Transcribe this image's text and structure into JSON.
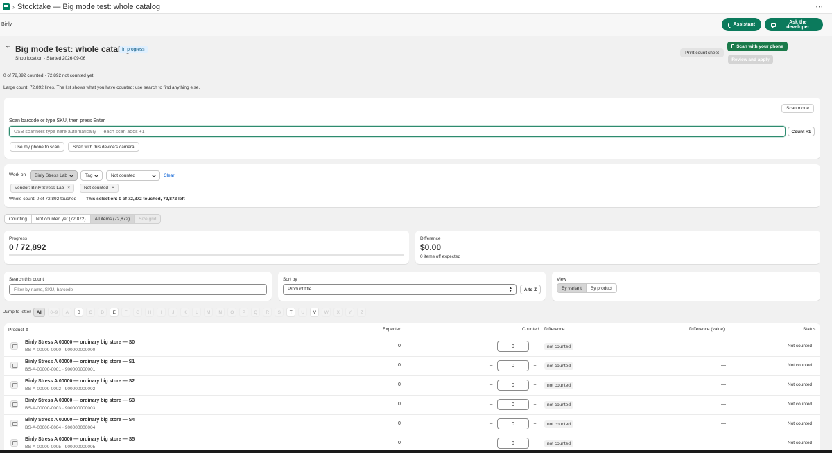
{
  "window": {
    "title": "Stocktake — Big mode test: whole catalog",
    "more": "⋯"
  },
  "appbar": {
    "brand": "Binly",
    "assistant": "Assistant",
    "ask_developer": "Ask the developer"
  },
  "header": {
    "title": "Big mode test: whole catalog",
    "status_badge": "In progress",
    "subtitle": "Shop location · Started 2026-09-06",
    "print_button": "Print count sheet",
    "scan_phone_button": "Scan with your phone",
    "review_button": "Review and apply",
    "counted_summary": "0 of 72,892 counted · 72,892 not counted yet",
    "large_note": "Large count: 72,892 lines. The list shows what you have counted; use search to find anything else."
  },
  "scan": {
    "mode_button": "Scan mode",
    "label": "Scan barcode or type SKU, then press Enter",
    "placeholder": "USB scanners type here automatically — each scan adds +1",
    "count_button": "Count +1",
    "phone_button": "Use my phone to scan",
    "camera_button": "Scan with this device's camera"
  },
  "filters": {
    "work_on_label": "Work on",
    "vendor_select": "Binly Stress Lab",
    "tag_select": "Tag",
    "status_select": "Not counted",
    "clear": "Clear",
    "chips": [
      "Vendor: Binly Stress Lab",
      "Not counted"
    ],
    "chip_remove": "×",
    "whole_count": "Whole count: 0 of 72,892 touched",
    "this_selection": "This selection: 0 of 72,872 touched, 72,872 left"
  },
  "tabs": [
    "Counting",
    "Not counted yet (72,872)",
    "All items (72,872)",
    "Size grid"
  ],
  "progress": {
    "label": "Progress",
    "value": "0 / 72,892",
    "fraction": 0.0
  },
  "difference": {
    "label": "Difference",
    "value": "$0.00",
    "sub": "0 items off expected"
  },
  "search": {
    "label": "Search this count",
    "placeholder": "Filter by name, SKU, barcode"
  },
  "sort": {
    "label": "Sort by",
    "value": "Product title",
    "order_button": "A to Z"
  },
  "view": {
    "label": "View",
    "by_variant": "By variant",
    "by_product": "By product"
  },
  "jump": {
    "label": "Jump to letter",
    "letters": [
      {
        "t": "All",
        "s": "active"
      },
      {
        "t": "0–9",
        "s": "disabled"
      },
      {
        "t": "A",
        "s": "disabled"
      },
      {
        "t": "B",
        "s": "enabled"
      },
      {
        "t": "C",
        "s": "disabled"
      },
      {
        "t": "D",
        "s": "disabled"
      },
      {
        "t": "E",
        "s": "enabled"
      },
      {
        "t": "F",
        "s": "disabled"
      },
      {
        "t": "G",
        "s": "disabled"
      },
      {
        "t": "H",
        "s": "disabled"
      },
      {
        "t": "I",
        "s": "disabled"
      },
      {
        "t": "J",
        "s": "disabled"
      },
      {
        "t": "K",
        "s": "disabled"
      },
      {
        "t": "L",
        "s": "disabled"
      },
      {
        "t": "M",
        "s": "disabled"
      },
      {
        "t": "N",
        "s": "disabled"
      },
      {
        "t": "O",
        "s": "disabled"
      },
      {
        "t": "P",
        "s": "disabled"
      },
      {
        "t": "Q",
        "s": "disabled"
      },
      {
        "t": "R",
        "s": "disabled"
      },
      {
        "t": "S",
        "s": "disabled"
      },
      {
        "t": "T",
        "s": "enabled"
      },
      {
        "t": "U",
        "s": "disabled"
      },
      {
        "t": "V",
        "s": "enabled"
      },
      {
        "t": "W",
        "s": "disabled"
      },
      {
        "t": "X",
        "s": "disabled"
      },
      {
        "t": "Y",
        "s": "disabled"
      },
      {
        "t": "Z",
        "s": "disabled"
      }
    ]
  },
  "table": {
    "headers": {
      "product": "Product",
      "expected": "Expected",
      "counted": "Counted",
      "difference": "Difference",
      "difference_value": "Difference (value)",
      "status": "Status"
    },
    "rows": [
      {
        "name": "Binly Stress A 00000 — ordinary big store — S0",
        "sku": "BS-A-00000-0000 · 900000000000",
        "expected": "0",
        "counted": "0",
        "diff": "not counted",
        "diff_value": "—",
        "status": "Not counted"
      },
      {
        "name": "Binly Stress A 00000 — ordinary big store — S1",
        "sku": "BS-A-00000-0001 · 900000000001",
        "expected": "0",
        "counted": "0",
        "diff": "not counted",
        "diff_value": "—",
        "status": "Not counted"
      },
      {
        "name": "Binly Stress A 00000 — ordinary big store — S2",
        "sku": "BS-A-00000-0002 · 900000000002",
        "expected": "0",
        "counted": "0",
        "diff": "not counted",
        "diff_value": "—",
        "status": "Not counted"
      },
      {
        "name": "Binly Stress A 00000 — ordinary big store — S3",
        "sku": "BS-A-00000-0003 · 900000000003",
        "expected": "0",
        "counted": "0",
        "diff": "not counted",
        "diff_value": "—",
        "status": "Not counted"
      },
      {
        "name": "Binly Stress A 00000 — ordinary big store — S4",
        "sku": "BS-A-00000-0004 · 900000000004",
        "expected": "0",
        "counted": "0",
        "diff": "not counted",
        "diff_value": "—",
        "status": "Not counted"
      },
      {
        "name": "Binly Stress A 00000 — ordinary big store — S5",
        "sku": "BS-A-00000-0005 · 900000000005",
        "expected": "0",
        "counted": "0",
        "diff": "not counted",
        "diff_value": "—",
        "status": "Not counted"
      }
    ],
    "minus": "−",
    "plus": "+"
  },
  "colors": {
    "brand_green": "#0b7a5c",
    "link_blue": "#005bd3",
    "badge_bg": "#e0f0ff"
  },
  "icons": [
    "app-icon",
    "chevron-right-icon",
    "more-icon",
    "chat-icon",
    "back-arrow-icon",
    "phone-icon",
    "chevron-down-icon",
    "close-icon",
    "sort-icon",
    "product-thumbnail-icon"
  ]
}
